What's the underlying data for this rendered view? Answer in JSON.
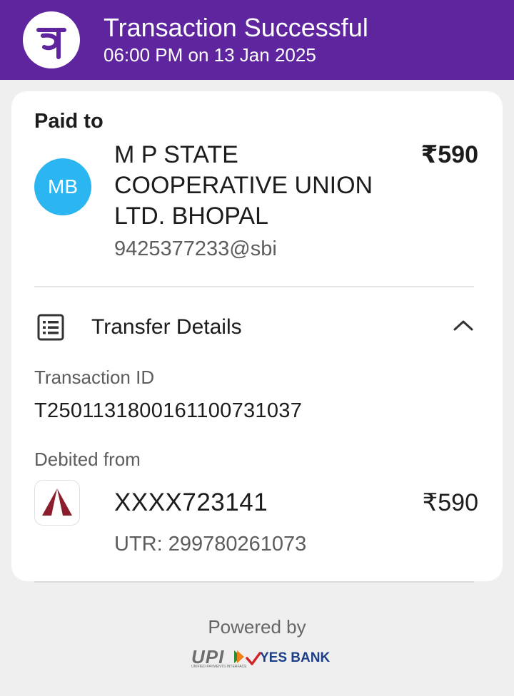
{
  "header": {
    "logo_glyph": "पे",
    "title": "Transaction Successful",
    "subtitle": "06:00 PM on 13 Jan 2025",
    "bg_color": "#5f259f"
  },
  "paid_to": {
    "label": "Paid to",
    "avatar_initials": "MB",
    "avatar_color": "#2bb5f1",
    "name": "M P STATE COOPERATIVE UNION LTD. BHOPAL",
    "upi_id": "9425377233@sbi",
    "amount": "₹590"
  },
  "transfer_details": {
    "icon": "list-icon",
    "title": "Transfer Details",
    "toggle_icon": "chevron-up-icon",
    "transaction_id_label": "Transaction ID",
    "transaction_id": "T2501131800161100731037",
    "debited_from_label": "Debited from",
    "bank_icon": "axis-bank-logo",
    "account_number": "XXXX723141",
    "amount": "₹590",
    "utr": "UTR: 299780261073"
  },
  "footer": {
    "powered_by": "Powered by",
    "upi_logo_text": "UPI",
    "upi_logo_subtext": "UNIFIED PAYMENTS INTERFACE",
    "bank_name": "YES BANK"
  }
}
